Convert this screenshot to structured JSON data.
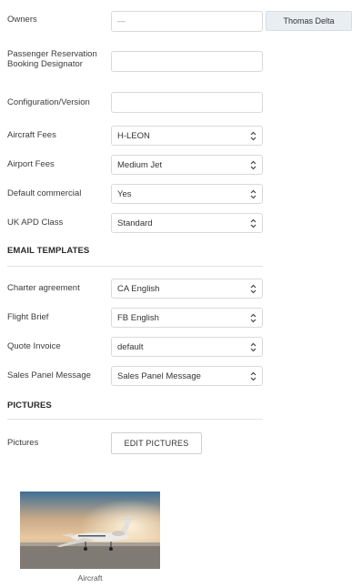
{
  "owners": {
    "label": "Owners",
    "value": "—",
    "button": "Thomas Delta"
  },
  "fields": {
    "prbd": {
      "label": "Passenger Reservation Booking Designator",
      "value": ""
    },
    "config": {
      "label": "Configuration/Version",
      "value": ""
    },
    "aircraft_fees": {
      "label": "Aircraft Fees",
      "value": "H-LEON"
    },
    "airport_fees": {
      "label": "Airport Fees",
      "value": "Medium Jet"
    },
    "default_commercial": {
      "label": "Default commercial",
      "value": "Yes"
    },
    "uk_apd": {
      "label": "UK APD Class",
      "value": "Standard"
    }
  },
  "email_templates": {
    "heading": "EMAIL TEMPLATES",
    "charter_agreement": {
      "label": "Charter agreement",
      "value": "CA English"
    },
    "flight_brief": {
      "label": "Flight Brief",
      "value": "FB English"
    },
    "quote_invoice": {
      "label": "Quote Invoice",
      "value": "default"
    },
    "sales_panel": {
      "label": "Sales Panel Message",
      "value": "Sales Panel Message"
    }
  },
  "pictures": {
    "heading": "PICTURES",
    "label": "Pictures",
    "edit_button": "EDIT PICTURES",
    "caption": "Aircraft"
  }
}
